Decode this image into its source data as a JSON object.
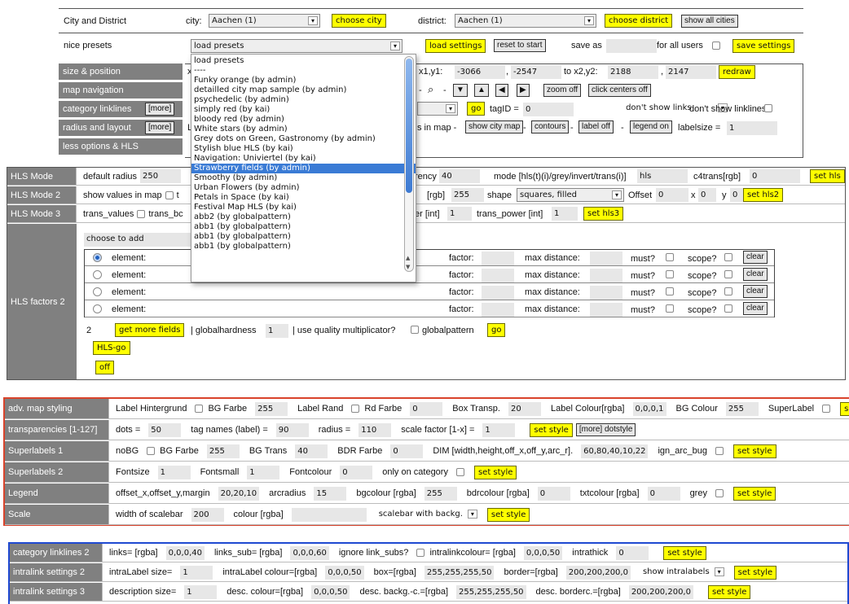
{
  "top": {
    "r1": {
      "label": "City and District",
      "city_label": "city:",
      "city_value": "Aachen (1)",
      "choose_city": "choose city",
      "district_label": "district:",
      "district_value": "Aachen (1)",
      "choose_district": "choose district",
      "show_all": "show all cities"
    },
    "r2": {
      "label": "nice presets",
      "presets_value": "load presets",
      "load_settings": "load settings",
      "reset": "reset to start",
      "save_as": "save as",
      "for_all": "for all users",
      "save_settings": "save settings"
    }
  },
  "menu": {
    "size_position": "size & position",
    "map_navigation": "map navigation",
    "category_linklines": "category linklines",
    "more": "[more]",
    "radius_layout": "radius and layout",
    "more2": "[more]",
    "less_options": "less options & HLS",
    "x_label": "x",
    "coords_label": "x1,y1:",
    "x1": "-3066",
    "sep": ",",
    "y1": "-2547",
    "to_label": "to x2,y2:",
    "x2": "2188",
    "y2": "2147",
    "redraw": "redraw",
    "zoom_minus": "-",
    "zoom_out": "zoom off",
    "click_centers": "click centers off",
    "go": "go",
    "tagid_label": "tagID =",
    "tagid": "0",
    "dont_show_links": "don't show links",
    "dont_show_linklines": "don't show linklines",
    "L": "L",
    "in_map": "s in map -",
    "show_city_map": "show city map",
    "dash1": "-",
    "contours": "contours",
    "dash2": "-",
    "label_off": "label off",
    "dash3": "-",
    "legend_on": "legend on",
    "labelsize_label": "labelsize =",
    "labelsize": "1"
  },
  "dropdown": {
    "items": [
      "load presets",
      "----",
      "Funky orange (by admin)",
      "detailled city map sample (by admin)",
      "psychedelic (by admin)",
      "simply red (by kai)",
      "bloody red (by admin)",
      "White stars (by admin)",
      "Grey dots on Green, Gastronomy (by admin)",
      "Stylish blue HLS (by kai)",
      "Navigation: Univiertel (by kai)",
      "Strawberry fields (by admin)",
      "Smoothy (by admin)",
      "Urban Flowers (by admin)",
      "Petals in Space (by kai)",
      "Festival Map HLS (by kai)",
      "abb2 (by globalpattern)",
      "abb1 (by globalpattern)",
      "abb1 (by globalpattern)",
      "abb1 (by globalpattern)"
    ],
    "selected": "Strawberry fields (by admin)"
  },
  "hls": {
    "m1": {
      "label": "HLS Mode",
      "radius_label": "default radius",
      "radius": "250",
      "trans_label": "rency",
      "trans": "40",
      "mode_label": "mode [hls(t)(i)/grey/invert/trans(i)]",
      "mode": "hls",
      "c4_label": "c4trans[rgb]",
      "c4": "0",
      "btn": "set hls"
    },
    "m2": {
      "label": "HLS Mode 2",
      "show_values": "show values in map",
      "t": "t",
      "rgb_label": "[rgb]",
      "rgb": "255",
      "shape_label": "shape",
      "shape": "squares, filled",
      "offset_label": "Offset",
      "offset": "0",
      "x_label": "x",
      "x": "0",
      "y_label": "y",
      "y": "0",
      "btn": "set hls2"
    },
    "m3": {
      "label": "HLS Mode 3",
      "trans_values": "trans_values",
      "trans_bc": "trans_bc",
      "er_label": "er [int]",
      "er": "1",
      "power_label": "trans_power [int]",
      "power": "1",
      "btn": "set hls3"
    },
    "f": {
      "label": "HLS factors 2",
      "choose": "choose to add",
      "rows": [
        {
          "element": "element:",
          "factor": "factor:",
          "maxdist": "max distance:",
          "must": "must?",
          "scope": "scope?",
          "clear": "clear"
        },
        {
          "element": "element:",
          "factor": "factor:",
          "maxdist": "max distance:",
          "must": "must?",
          "scope": "scope?",
          "clear": "clear"
        },
        {
          "element": "element:",
          "factor": "factor:",
          "maxdist": "max distance:",
          "must": "must?",
          "scope": "scope?",
          "clear": "clear"
        },
        {
          "element": "element:",
          "factor": "factor:",
          "maxdist": "max distance:",
          "must": "must?",
          "scope": "scope?",
          "clear": "clear"
        }
      ],
      "count": "2",
      "more_fields": "get more fields",
      "hardness_label": "| globalhardness",
      "hardness": "1",
      "quality": "| use quality multiplicator?",
      "globalpattern": "globalpattern",
      "go": "go",
      "hls_go": "HLS-go",
      "off": "off"
    }
  },
  "adv": [
    {
      "label": "adv. map styling",
      "content": [
        [
          "t",
          "Label Hintergrund"
        ],
        [
          "c"
        ],
        [
          "t",
          "BG Farbe"
        ],
        [
          "i",
          "255"
        ],
        [
          "t",
          "Label Rand"
        ],
        [
          "c"
        ],
        [
          "t",
          "Rd Farbe"
        ],
        [
          "i",
          "0"
        ],
        [
          "t",
          "Box Transp."
        ],
        [
          "i",
          "20"
        ],
        [
          "t",
          "Label Colour[rgba]"
        ],
        [
          "i",
          "0,0,0,1"
        ],
        [
          "t",
          "BG Colour"
        ],
        [
          "i",
          "255"
        ],
        [
          "t",
          "SuperLabel"
        ],
        [
          "c"
        ],
        [
          "b",
          "set style"
        ]
      ]
    },
    {
      "label": "transparencies [1-127]",
      "content": [
        [
          "t",
          "dots ="
        ],
        [
          "i",
          "50"
        ],
        [
          "t",
          "tag names (label) ="
        ],
        [
          "i",
          "90"
        ],
        [
          "t",
          "radius ="
        ],
        [
          "i",
          "110"
        ],
        [
          "t",
          "scale factor [1-x] ="
        ],
        [
          "i",
          "1"
        ],
        [
          "b",
          "set style"
        ],
        [
          "g",
          "[more] dotstyle"
        ]
      ]
    },
    {
      "label": "Superlabels 1",
      "content": [
        [
          "t",
          "noBG"
        ],
        [
          "c"
        ],
        [
          "t",
          "BG Farbe"
        ],
        [
          "i",
          "255"
        ],
        [
          "t",
          "BG Trans"
        ],
        [
          "i",
          "40"
        ],
        [
          "t",
          "BDR Farbe"
        ],
        [
          "i",
          "0"
        ],
        [
          "t",
          "DIM [width,height,off_x,off_y,arc_r]."
        ],
        [
          "i",
          "60,80,40,10,22"
        ],
        [
          "t",
          "ign_arc_bug"
        ],
        [
          "c"
        ],
        [
          "b",
          "set style"
        ]
      ]
    },
    {
      "label": "Superlabels 2",
      "content": [
        [
          "t",
          "Fontsize"
        ],
        [
          "i",
          "1"
        ],
        [
          "t",
          "Fontsmall"
        ],
        [
          "i",
          "1"
        ],
        [
          "t",
          "Fontcolour"
        ],
        [
          "i",
          "0"
        ],
        [
          "t",
          "only on category"
        ],
        [
          "c"
        ],
        [
          "b",
          "set style"
        ]
      ]
    },
    {
      "label": "Legend",
      "content": [
        [
          "t",
          "offset_x,offset_y,margin"
        ],
        [
          "i",
          "20,20,10"
        ],
        [
          "t",
          "arcradius"
        ],
        [
          "i",
          "15"
        ],
        [
          "t",
          "bgcolour [rgba]"
        ],
        [
          "i",
          "255"
        ],
        [
          "t",
          "bdrcolour [rgba]"
        ],
        [
          "i",
          "0"
        ],
        [
          "t",
          "txtcolour [rgba]"
        ],
        [
          "i",
          "0"
        ],
        [
          "t",
          "grey"
        ],
        [
          "c"
        ],
        [
          "b",
          "set style"
        ]
      ]
    },
    {
      "label": "Scale",
      "content": [
        [
          "t",
          "width of scalebar"
        ],
        [
          "i",
          "200"
        ],
        [
          "t",
          "colour [rgba]"
        ],
        [
          "i",
          ""
        ],
        [
          "s",
          "scalebar with backg."
        ],
        [
          "b",
          "set style"
        ]
      ]
    }
  ],
  "blue": [
    {
      "label": "category linklines 2",
      "content": [
        [
          "t",
          "links= [rgba]"
        ],
        [
          "i",
          "0,0,0,40"
        ],
        [
          "t",
          "links_sub= [rgba]"
        ],
        [
          "i",
          "0,0,0,60"
        ],
        [
          "t",
          "ignore link_subs?"
        ],
        [
          "c"
        ],
        [
          "t",
          "intralinkcolour= [rgba]"
        ],
        [
          "i",
          "0,0,0,50"
        ],
        [
          "t",
          "intrathick"
        ],
        [
          "i",
          "0"
        ],
        [
          "b",
          "set style"
        ]
      ]
    },
    {
      "label": "intralink settings 2",
      "content": [
        [
          "t",
          "intraLabel size="
        ],
        [
          "i",
          "1"
        ],
        [
          "t",
          "intraLabel colour=[rgba]"
        ],
        [
          "i",
          "0,0,0,50"
        ],
        [
          "t",
          "box=[rgba]"
        ],
        [
          "i",
          "255,255,255,50"
        ],
        [
          "t",
          "border=[rgba]"
        ],
        [
          "i",
          "200,200,200,0"
        ],
        [
          "s",
          "show intralabels"
        ],
        [
          "b",
          "set style"
        ]
      ]
    },
    {
      "label": "intralink settings 3",
      "content": [
        [
          "t",
          "description size="
        ],
        [
          "i",
          "1"
        ],
        [
          "t",
          "desc. colour=[rgba]"
        ],
        [
          "i",
          "0,0,0,50"
        ],
        [
          "t",
          "desc. backg.-c.=[rgba]"
        ],
        [
          "i",
          "255,255,255,50"
        ],
        [
          "t",
          "desc. borderc.=[rgba]"
        ],
        [
          "i",
          "200,200,200,0"
        ],
        [
          "b",
          "set style"
        ]
      ]
    }
  ],
  "colors": {
    "label_bg": "#808080",
    "button": "#ffff00",
    "red_border": "#d9432b",
    "blue_border": "#1f49d1",
    "highlight": "#3a7bd5"
  }
}
